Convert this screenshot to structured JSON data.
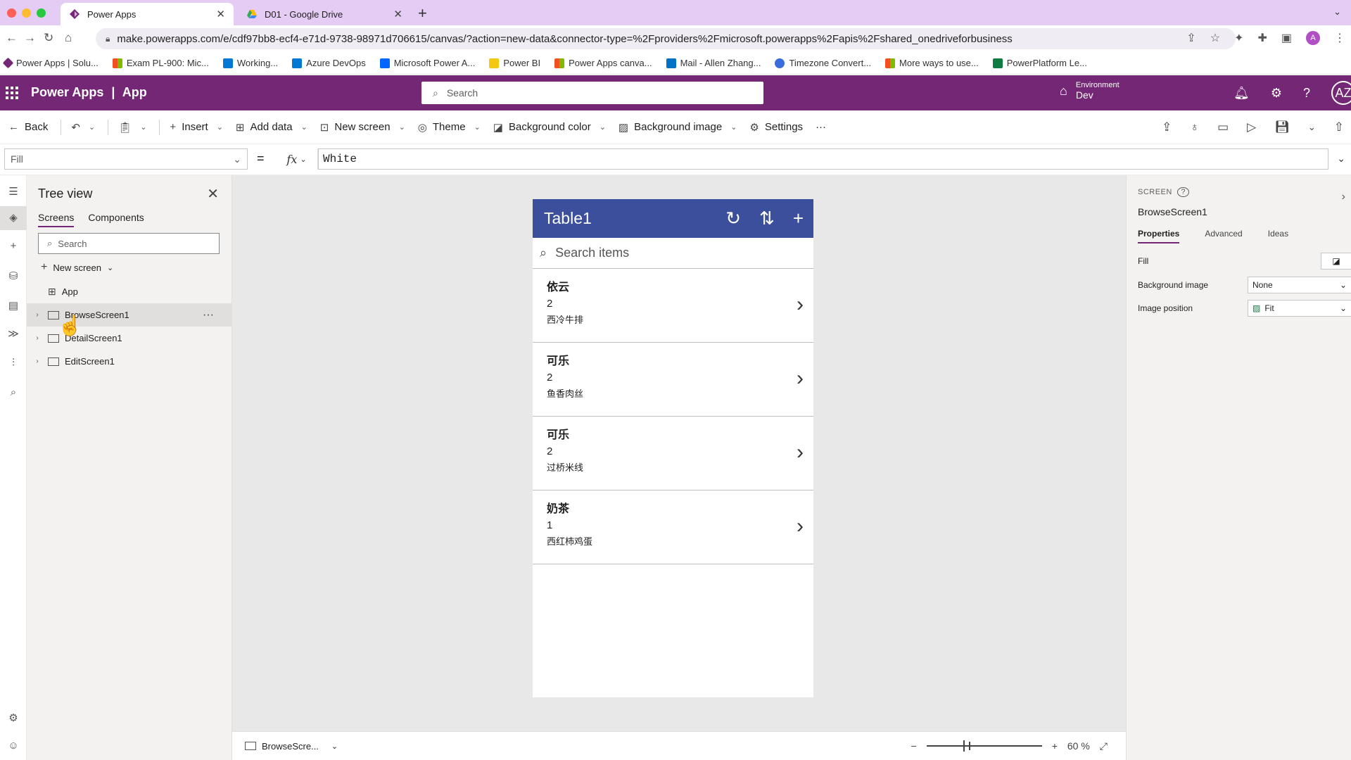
{
  "browser": {
    "tabs": [
      {
        "title": "Power Apps"
      },
      {
        "title": "D01 - Google Drive"
      }
    ],
    "url": "make.powerapps.com/e/cdf97bb8-ecf4-e71d-9738-98971d706615/canvas/?action=new-data&connector-type=%2Fproviders%2Fmicrosoft.powerapps%2Fapis%2Fshared_onedriveforbusiness",
    "profile_initial": "A",
    "bookmarks": [
      {
        "label": "Power Apps | Solu...",
        "color": "#742774"
      },
      {
        "label": "Exam PL-900: Mic...",
        "color": "#f25022"
      },
      {
        "label": "Working...",
        "color": "#0078d4"
      },
      {
        "label": "Azure DevOps",
        "color": "#0078d4"
      },
      {
        "label": "Microsoft Power A...",
        "color": "#0066ff"
      },
      {
        "label": "Power BI",
        "color": "#f2c811"
      },
      {
        "label": "Power Apps canva...",
        "color": "#f25022"
      },
      {
        "label": "Mail - Allen Zhang...",
        "color": "#0072c6"
      },
      {
        "label": "Timezone Convert...",
        "color": "#3a6cdb"
      },
      {
        "label": "More ways to use...",
        "color": "#f25022"
      },
      {
        "label": "PowerPlatform Le...",
        "color": "#107c41"
      }
    ]
  },
  "appbar": {
    "product": "Power Apps",
    "divider": "|",
    "app_name": "App",
    "search_placeholder": "Search",
    "env_label": "Environment",
    "env_value": "Dev",
    "user_initials": "AZ"
  },
  "commandbar": {
    "back": "Back",
    "insert": "Insert",
    "add_data": "Add data",
    "new_screen": "New screen",
    "theme": "Theme",
    "background_color": "Background color",
    "background_image": "Background image",
    "settings": "Settings",
    "more": "···"
  },
  "formula": {
    "property": "Fill",
    "equals": "=",
    "fx": "fx",
    "value": "White"
  },
  "tree": {
    "title": "Tree view",
    "tabs": [
      "Screens",
      "Components"
    ],
    "search_placeholder": "Search",
    "new_screen": "New screen",
    "app_item": "App",
    "screens": [
      "BrowseScreen1",
      "DetailScreen1",
      "EditScreen1"
    ],
    "more": "···"
  },
  "phone": {
    "title": "Table1",
    "search_placeholder": "Search items",
    "items": [
      {
        "title": "依云",
        "subtitle": "2",
        "body": "西冷牛排"
      },
      {
        "title": "可乐",
        "subtitle": "2",
        "body": "鱼香肉丝"
      },
      {
        "title": "可乐",
        "subtitle": "2",
        "body": "过桥米线"
      },
      {
        "title": "奶茶",
        "subtitle": "1",
        "body": "西红柿鸡蛋"
      }
    ]
  },
  "statusbar": {
    "screen": "BrowseScre...",
    "zoom_value": "60",
    "zoom_unit": "%"
  },
  "properties": {
    "kind": "SCREEN",
    "name": "BrowseScreen1",
    "tabs": [
      "Properties",
      "Advanced",
      "Ideas"
    ],
    "fill_label": "Fill",
    "bg_image_label": "Background image",
    "bg_image_value": "None",
    "img_pos_label": "Image position",
    "img_pos_value": "Fit"
  },
  "colors": {
    "app_header": "#742774",
    "phone_header": "#3b4f9c",
    "tab_strip": "#e4ccf4"
  }
}
